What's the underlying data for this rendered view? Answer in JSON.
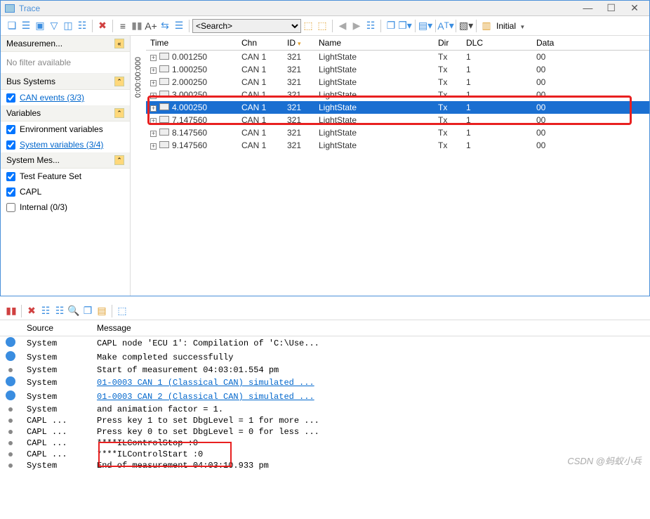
{
  "window": {
    "title": "Trace",
    "controls": [
      "—",
      "☐",
      "✕"
    ]
  },
  "toolbar": {
    "search_placeholder": "<Search>",
    "initial_label": "Initial"
  },
  "sidebar": {
    "measurement_hdr": "Measuremen...",
    "no_filter": "No filter available",
    "bus_systems_hdr": "Bus Systems",
    "can_events": "CAN events (3/3)",
    "variables_hdr": "Variables",
    "env_var": "Environment variables",
    "sys_var": "System variables (3/4)",
    "sys_mes_hdr": "System Mes...",
    "test_feature": "Test Feature Set",
    "capl": "CAPL",
    "internal": "Internal (0/3)"
  },
  "time_axis": "0:00:00:000",
  "grid": {
    "headers": [
      "Time",
      "Chn",
      "ID",
      "Name",
      "Dir",
      "DLC",
      "Data"
    ],
    "rows": [
      {
        "time": "0.001250",
        "chn": "CAN 1",
        "id": "321",
        "name": "LightState",
        "dir": "Tx",
        "dlc": "1",
        "data": "00",
        "sel": false
      },
      {
        "time": "1.000250",
        "chn": "CAN 1",
        "id": "321",
        "name": "LightState",
        "dir": "Tx",
        "dlc": "1",
        "data": "00",
        "sel": false
      },
      {
        "time": "2.000250",
        "chn": "CAN 1",
        "id": "321",
        "name": "LightState",
        "dir": "Tx",
        "dlc": "1",
        "data": "00",
        "sel": false
      },
      {
        "time": "3.000250",
        "chn": "CAN 1",
        "id": "321",
        "name": "LightState",
        "dir": "Tx",
        "dlc": "1",
        "data": "00",
        "sel": false
      },
      {
        "time": "4.000250",
        "chn": "CAN 1",
        "id": "321",
        "name": "LightState",
        "dir": "Tx",
        "dlc": "1",
        "data": "00",
        "sel": true
      },
      {
        "time": "7.147560",
        "chn": "CAN 1",
        "id": "321",
        "name": "LightState",
        "dir": "Tx",
        "dlc": "1",
        "data": "00",
        "sel": false
      },
      {
        "time": "8.147560",
        "chn": "CAN 1",
        "id": "321",
        "name": "LightState",
        "dir": "Tx",
        "dlc": "1",
        "data": "00",
        "sel": false
      },
      {
        "time": "9.147560",
        "chn": "CAN 1",
        "id": "321",
        "name": "LightState",
        "dir": "Tx",
        "dlc": "1",
        "data": "00",
        "sel": false
      }
    ]
  },
  "log": {
    "headers": [
      "Source",
      "Message"
    ],
    "rows": [
      {
        "icon": "info",
        "src": "System",
        "msg": "CAPL node 'ECU 1': Compilation of 'C:\\Use...",
        "link": false
      },
      {
        "icon": "info",
        "src": "System",
        "msg": "Make completed successfully",
        "link": false
      },
      {
        "icon": "dot",
        "src": "System",
        "msg": "Start of measurement 04:03:01.554 pm",
        "link": false
      },
      {
        "icon": "info",
        "src": "System",
        "msg": "01-0003 CAN 1 (Classical CAN)  simulated ...",
        "link": true
      },
      {
        "icon": "info",
        "src": "System",
        "msg": "01-0003 CAN 2 (Classical CAN)  simulated ...",
        "link": true
      },
      {
        "icon": "dot",
        "src": "System",
        "msg": "  and animation factor = 1.",
        "link": false
      },
      {
        "icon": "dot",
        "src": "CAPL ...",
        "msg": "Press key 1 to set DbgLevel = 1 for more ...",
        "link": false
      },
      {
        "icon": "dot",
        "src": "CAPL ...",
        "msg": "Press key 0 to set DbgLevel = 0 for less ...",
        "link": false
      },
      {
        "icon": "dot",
        "src": "CAPL ...",
        "msg": "****ILControlStop :0",
        "link": false
      },
      {
        "icon": "dot",
        "src": "CAPL ...",
        "msg": "****ILControlStart :0",
        "link": false
      },
      {
        "icon": "dot",
        "src": "System",
        "msg": "End of measurement 04:03:10.933 pm",
        "link": false
      }
    ]
  },
  "watermark": "CSDN @蚂蚁小兵"
}
